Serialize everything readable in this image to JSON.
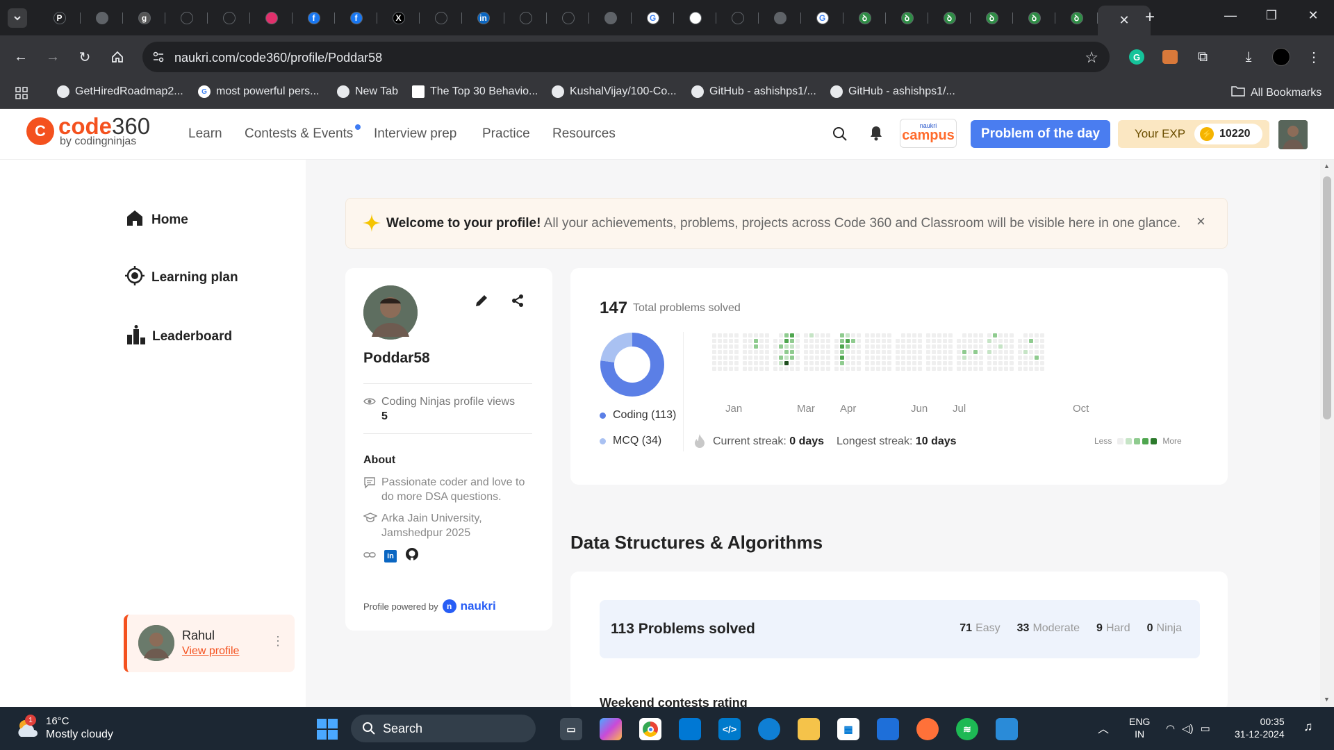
{
  "browser": {
    "url": "naukri.com/code360/profile/Poddar58",
    "tabs": [
      {
        "icon": "p-icon",
        "color": "#202124",
        "glyph": "P"
      },
      {
        "icon": "globe-icon",
        "color": "#5f6368",
        "glyph": ""
      },
      {
        "icon": "g-icon",
        "color": "#555",
        "glyph": "g"
      },
      {
        "icon": "github-icon",
        "color": "#202124",
        "glyph": ""
      },
      {
        "icon": "react-icon",
        "color": "#202124",
        "glyph": ""
      },
      {
        "icon": "instagram-icon",
        "color": "#e1306c",
        "glyph": ""
      },
      {
        "icon": "facebook-icon",
        "color": "#1877f2",
        "glyph": "f"
      },
      {
        "icon": "facebook-icon",
        "color": "#1877f2",
        "glyph": "f"
      },
      {
        "icon": "x-icon",
        "color": "#000",
        "glyph": "X"
      },
      {
        "icon": "github-icon",
        "color": "#202124",
        "glyph": ""
      },
      {
        "icon": "linkedin-icon",
        "color": "#0a66c2",
        "glyph": "in"
      },
      {
        "icon": "openai-icon",
        "color": "#202124",
        "glyph": ""
      },
      {
        "icon": "react-icon",
        "color": "#202124",
        "glyph": ""
      },
      {
        "icon": "globe-icon",
        "color": "#5f6368",
        "glyph": ""
      },
      {
        "icon": "google-icon",
        "color": "#fff",
        "glyph": "G"
      },
      {
        "icon": "chat-icon",
        "color": "#fff",
        "glyph": ""
      },
      {
        "icon": "code-icon",
        "color": "#202124",
        "glyph": ""
      },
      {
        "icon": "globe-icon",
        "color": "#5f6368",
        "glyph": ""
      },
      {
        "icon": "google-icon",
        "color": "#fff",
        "glyph": "G"
      },
      {
        "icon": "gfg-icon",
        "color": "#2f8d46",
        "glyph": "ꝺ"
      },
      {
        "icon": "gfg-icon",
        "color": "#2f8d46",
        "glyph": "ꝺ"
      },
      {
        "icon": "gfg-icon",
        "color": "#2f8d46",
        "glyph": "ꝺ"
      },
      {
        "icon": "gfg-icon",
        "color": "#2f8d46",
        "glyph": "ꝺ"
      },
      {
        "icon": "gfg-icon",
        "color": "#2f8d46",
        "glyph": "ꝺ"
      },
      {
        "icon": "gfg-icon",
        "color": "#2f8d46",
        "glyph": "ꝺ"
      }
    ],
    "bookmarks": [
      {
        "label": "GetHiredRoadmap2...",
        "icon": "github-icon"
      },
      {
        "label": "most powerful pers...",
        "icon": "google-icon"
      },
      {
        "label": "New Tab",
        "icon": "globe-icon"
      },
      {
        "label": "The Top 30 Behavio...",
        "icon": "page-icon"
      },
      {
        "label": "KushalVijay/100-Co...",
        "icon": "github-icon"
      },
      {
        "label": "GitHub - ashishps1/...",
        "icon": "github-icon"
      },
      {
        "label": "GitHub - ashishps1/...",
        "icon": "github-icon"
      }
    ],
    "all_bookmarks": "All Bookmarks"
  },
  "header": {
    "logo_main": "code",
    "logo_num": "360",
    "logo_sub": "by codingninjas",
    "nav": [
      "Learn",
      "Contests & Events",
      "Interview prep",
      "Practice",
      "Resources"
    ],
    "campus_top": "naukri",
    "campus": "campus",
    "potd": "Problem of the day",
    "exp_label": "Your EXP",
    "exp_value": "10220"
  },
  "sidebar": {
    "items": [
      "Home",
      "Learning plan",
      "Leaderboard"
    ],
    "user_name": "Rahul",
    "user_link": "View profile"
  },
  "welcome": {
    "title": "Welcome to your profile!",
    "text": "All your achievements, problems, projects across Code 360 and Classroom will be visible here in one glance."
  },
  "profile": {
    "username": "Poddar58",
    "views_label": "Coding Ninjas profile views",
    "views": "5",
    "about_title": "About",
    "bio": "Passionate coder and love to do more DSA questions.",
    "college": "Arka Jain University, Jamshedpur 2025",
    "powered_by": "Profile powered by",
    "naukri": "naukri"
  },
  "stats": {
    "total": "147",
    "total_label": "Total problems solved",
    "coding_label": "Coding (113)",
    "mcq_label": "MCQ (34)",
    "months": [
      "Jan",
      "Mar",
      "Apr",
      "Jun",
      "Jul",
      "Oct"
    ],
    "current_streak_label": "Current streak:",
    "current_streak": "0 days",
    "longest_streak_label": "Longest streak:",
    "longest_streak": "10 days",
    "less": "Less",
    "more": "More",
    "colors": {
      "coding": "#5b7fe6",
      "mcq": "#a9c1f2"
    }
  },
  "chart_data": {
    "type": "pie",
    "categories": [
      "Coding",
      "MCQ"
    ],
    "values": [
      113,
      34
    ]
  },
  "dsa": {
    "title": "Data Structures & Algorithms",
    "solved": "113 Problems solved",
    "easy": "71",
    "easy_label": "Easy",
    "moderate": "33",
    "moderate_label": "Moderate",
    "hard": "9",
    "hard_label": "Hard",
    "ninja": "0",
    "ninja_label": "Ninja",
    "weekend": "Weekend contests rating"
  },
  "taskbar": {
    "temp": "16°C",
    "weather": "Mostly cloudy",
    "weather_badge": "1",
    "search": "Search",
    "lang1": "ENG",
    "lang2": "IN",
    "time": "00:35",
    "date": "31-12-2024"
  }
}
